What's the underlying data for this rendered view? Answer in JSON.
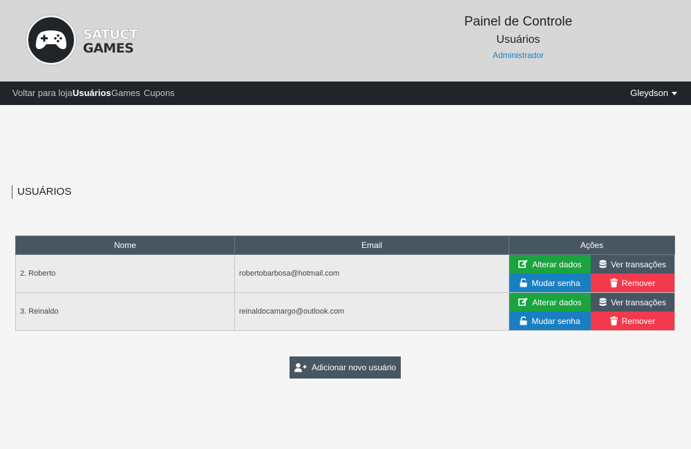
{
  "brand": {
    "line1": "SATUCT",
    "line2": "GAMES"
  },
  "header": {
    "title": "Painel de Controle",
    "subtitle": "Usuários",
    "role": "Administrador"
  },
  "nav": {
    "items": [
      "Voltar para loja",
      "Usuários",
      "Games",
      "Cupons"
    ],
    "active": "Usuários",
    "user": "Gleydson"
  },
  "section": {
    "title": "USUÁRIOS"
  },
  "table": {
    "headers": [
      "Nome",
      "Email",
      "Ações"
    ],
    "rows": [
      {
        "name": "2. Roberto",
        "email": "robertobarbosa@hotmail.com"
      },
      {
        "name": "3. Reinaldo",
        "email": "reinaldocamargo@outlook.com"
      }
    ],
    "actions": {
      "edit": "Alterar dados",
      "transactions": "Ver transações",
      "password": "Mudar senha",
      "remove": "Remover"
    }
  },
  "add_button": "Adicionar novo usuário",
  "colors": {
    "header_bg": "#d7d7d7",
    "navbar_bg": "#212529",
    "table_header": "#475663",
    "edit": "#1aa33e",
    "password": "#1a7fc1",
    "remove": "#f23a4c",
    "link": "#1a7fc1"
  },
  "icons": {
    "logo": "gamepad-icon",
    "edit": "edit-icon",
    "transactions": "database-icon",
    "password": "unlock-icon",
    "remove": "trash-icon",
    "add": "user-plus-icon",
    "dropdown": "caret-down-icon"
  }
}
